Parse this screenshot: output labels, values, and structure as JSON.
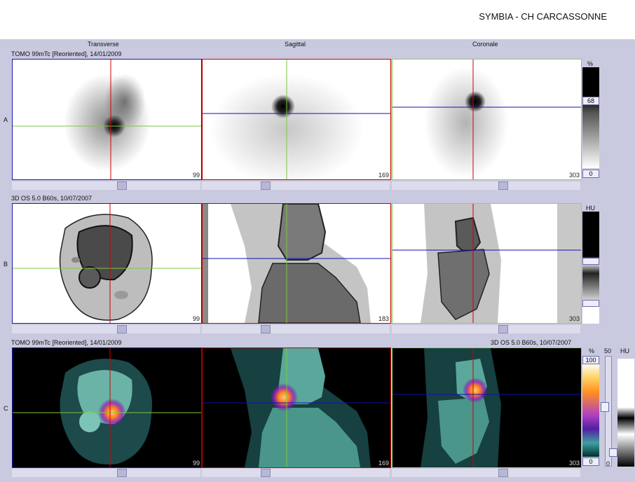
{
  "header": {
    "site": "SYMBIA - CH CARCASSONNE"
  },
  "columns": [
    "Transverse",
    "Sagittal",
    "Coronale"
  ],
  "rows": [
    {
      "id": "A",
      "series": "TOMO 99mTc [Reoriented], 14/01/2009",
      "slices": [
        "99",
        "169",
        "303"
      ]
    },
    {
      "id": "B",
      "series": "3D  OS  5.0  B60s, 10/07/2007",
      "slices": [
        "99",
        "183",
        "303"
      ]
    },
    {
      "id": "C",
      "series": "TOMO 99mTc [Reoriented], 14/01/2009",
      "series_right": "3D  OS  5.0  B60s, 10/07/2007",
      "slices": [
        "99",
        "169",
        "303"
      ]
    }
  ],
  "scales": {
    "a": {
      "unit": "%",
      "top": "68",
      "bottom": "0"
    },
    "b": {
      "unit": "HU"
    },
    "c": {
      "unit": "%",
      "top": "100",
      "bottom": "0",
      "window": "50",
      "unit2": "HU",
      "window_bottom": "0"
    }
  },
  "colors": {
    "crosshair_vertical": "#d00000",
    "crosshair_horizontal_green": "#7ec83c",
    "crosshair_horizontal_blue": "#1010b0",
    "border_blue": "#1818b0",
    "border_red": "#c80000",
    "border_green": "#8fd25a"
  }
}
